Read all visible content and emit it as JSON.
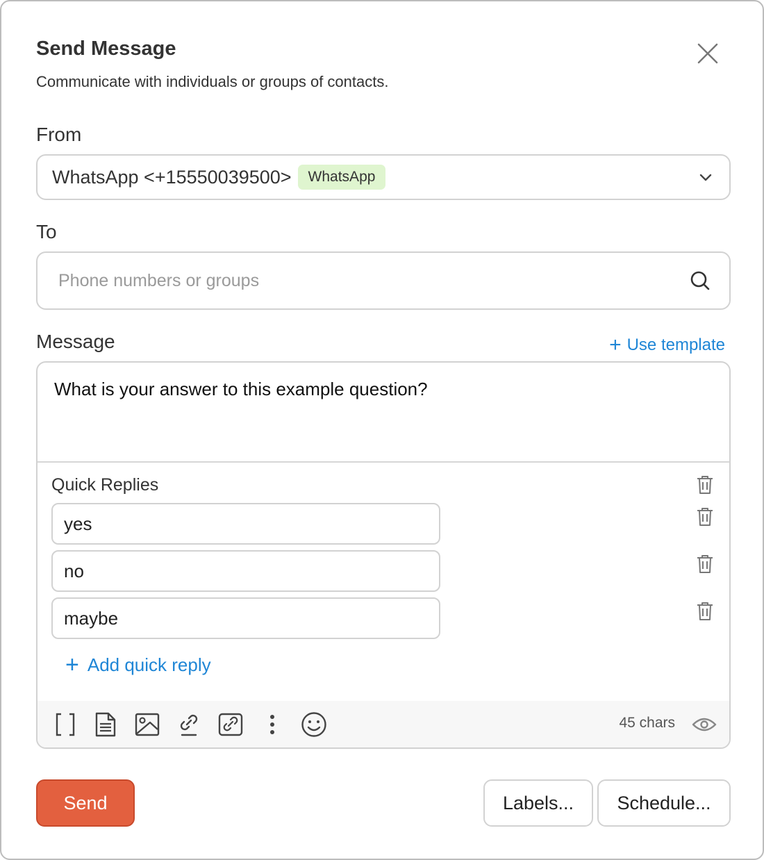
{
  "dialog": {
    "title": "Send Message",
    "subtitle": "Communicate with individuals or groups of contacts."
  },
  "from": {
    "label": "From",
    "value": "WhatsApp <+15550039500>",
    "badge": "WhatsApp",
    "badge_color": "#dff5cf"
  },
  "to": {
    "label": "To",
    "placeholder": "Phone numbers or groups",
    "value": ""
  },
  "message": {
    "label": "Message",
    "use_template_label": "Use template",
    "text": "What is your answer to this example question?",
    "char_count": "45 chars"
  },
  "quick_replies": {
    "title": "Quick Replies",
    "items": [
      "yes",
      "no",
      "maybe"
    ],
    "add_label": "Add quick reply"
  },
  "toolbar": {
    "icons": [
      "placeholder-brackets-icon",
      "document-icon",
      "image-icon",
      "link-icon",
      "link-box-icon",
      "more-vertical-icon",
      "emoji-icon"
    ]
  },
  "actions": {
    "send_label": "Send",
    "labels_label": "Labels...",
    "schedule_label": "Schedule..."
  },
  "colors": {
    "accent": "#1f86d6",
    "send": "#e3603f"
  }
}
